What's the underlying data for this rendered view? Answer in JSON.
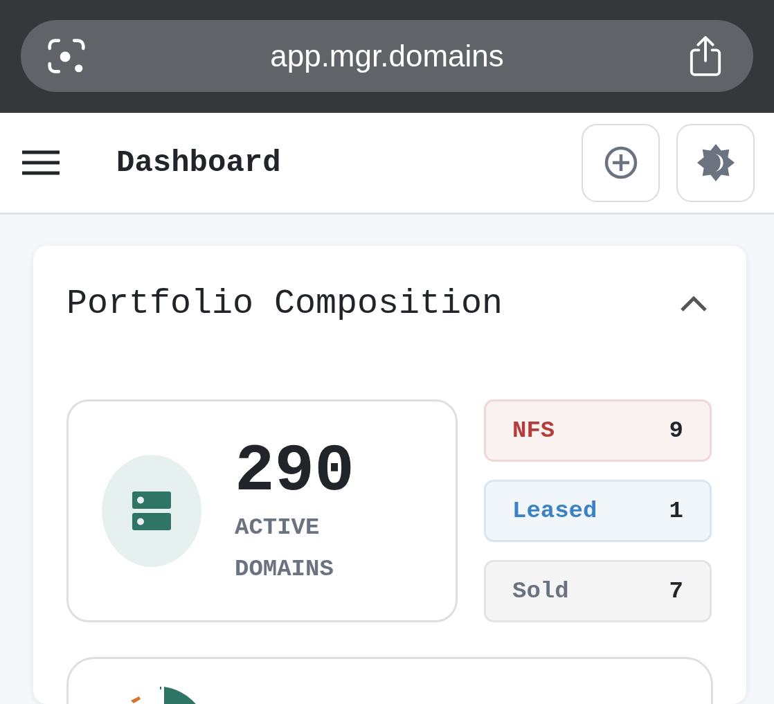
{
  "browser": {
    "url": "app.mgr.domains"
  },
  "header": {
    "title": "Dashboard"
  },
  "portfolio": {
    "title": "Portfolio Composition",
    "expanded": true,
    "active": {
      "count": "290",
      "label": "ACTIVE DOMAINS"
    },
    "statuses": [
      {
        "label": "NFS",
        "count": "9",
        "color": "#b83b3b"
      },
      {
        "label": "Leased",
        "count": "1",
        "color": "#3b82c4"
      },
      {
        "label": "Sold",
        "count": "7",
        "color": "#6b7280"
      }
    ]
  }
}
